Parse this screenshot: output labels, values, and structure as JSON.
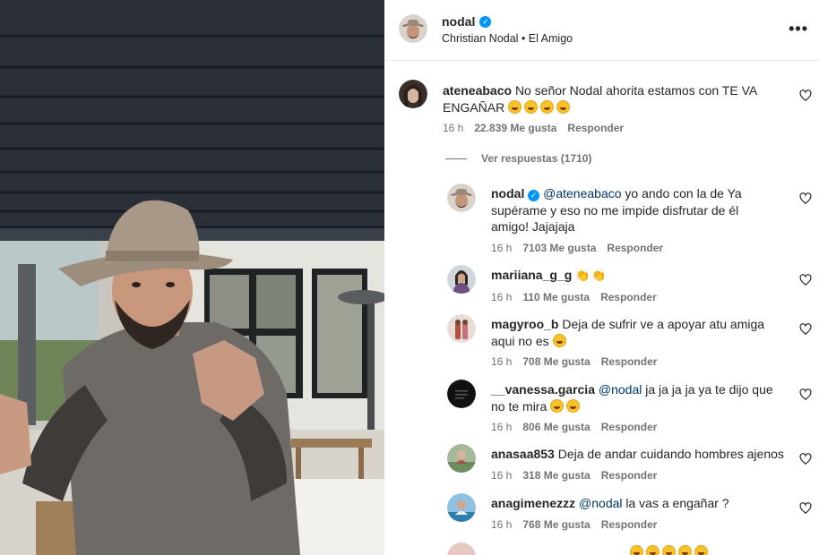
{
  "post": {
    "username": "nodal",
    "verified": true,
    "audio": "Christian Nodal • El Amigo",
    "more_icon": "more-icon"
  },
  "comments": [
    {
      "username": "ateneabaco",
      "verified": false,
      "mention": "",
      "text": "No señor Nodal ahorita estamos con TE VA ENGAÑAR",
      "emoji": [
        "laughing-emoji",
        "laughing-emoji",
        "laughing-emoji",
        "laughing-emoji"
      ],
      "time": "16 h",
      "likes": "22.839 Me gusta",
      "reply": "Responder",
      "view_replies": "Ver respuestas (1710)"
    },
    {
      "username": "nodal",
      "verified": true,
      "mention": "@ateneabaco",
      "text": "yo ando con la de Ya supérame y eso no me impide disfrutar de él amigo! Jajajaja",
      "emoji": [],
      "time": "16 h",
      "likes": "7103 Me gusta",
      "reply": "Responder"
    },
    {
      "username": "mariiana_g_g",
      "verified": false,
      "mention": "",
      "text": "",
      "emoji": [
        "clapping-emoji",
        "clapping-emoji"
      ],
      "time": "16 h",
      "likes": "110 Me gusta",
      "reply": "Responder"
    },
    {
      "username": "magyroo_b",
      "verified": false,
      "mention": "",
      "text": "Deja de sufrir ve a apoyar atu amiga aqui no es",
      "emoji": [
        "laughing-emoji"
      ],
      "time": "16 h",
      "likes": "708 Me gusta",
      "reply": "Responder"
    },
    {
      "username": "__vanessa.garcia",
      "verified": false,
      "mention": "@nodal",
      "text": "ja ja ja ja ya te dijo que no te mira",
      "emoji": [
        "laughing-emoji",
        "laughing-emoji"
      ],
      "time": "16 h",
      "likes": "806 Me gusta",
      "reply": "Responder"
    },
    {
      "username": "anasaa853",
      "verified": false,
      "mention": "",
      "text": "Deja de andar cuidando hombres ajenos",
      "emoji": [],
      "time": "16 h",
      "likes": "318 Me gusta",
      "reply": "Responder"
    },
    {
      "username": "anagimenezzz",
      "verified": false,
      "mention": "@nodal",
      "text": "la vas a engañar ?",
      "emoji": [],
      "time": "16 h",
      "likes": "768 Me gusta",
      "reply": "Responder"
    }
  ],
  "colors": {
    "accent": "#0095f6",
    "mention": "#00376b",
    "meta": "#737373",
    "text": "#262626"
  }
}
